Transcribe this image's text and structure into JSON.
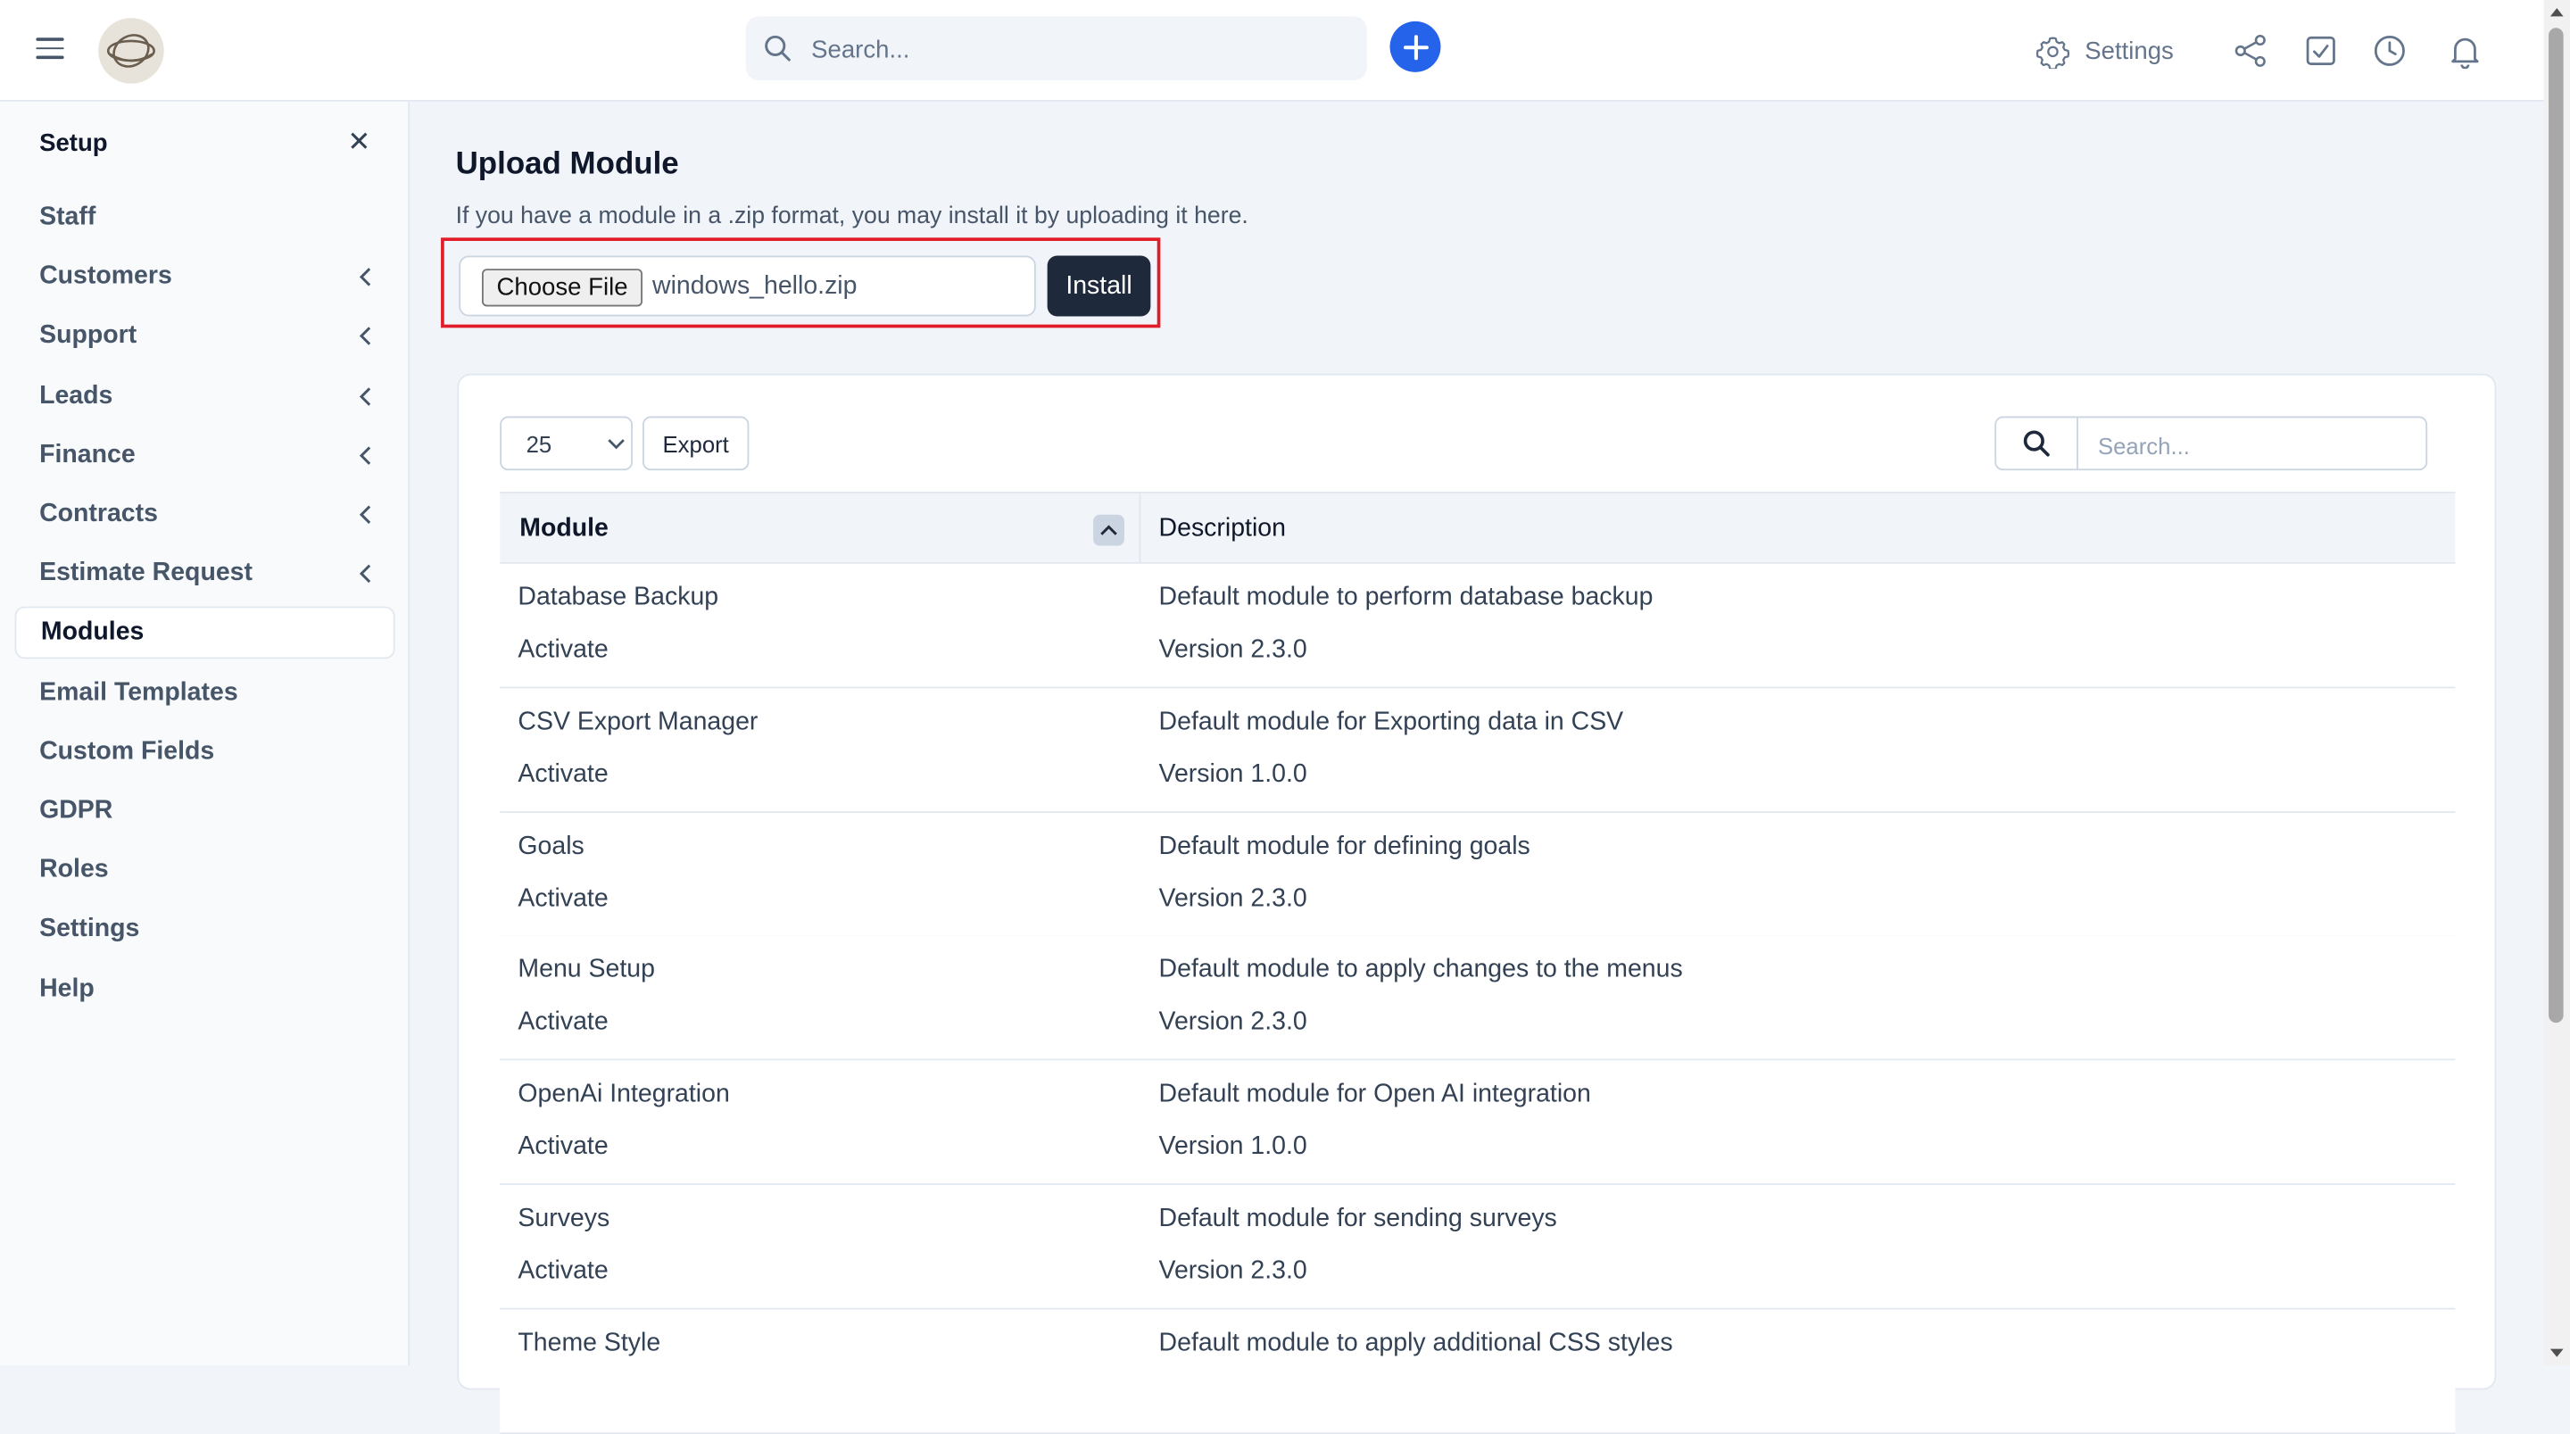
{
  "header": {
    "search_placeholder": "Search...",
    "settings_label": "Settings",
    "icons": [
      "menu-icon",
      "search-icon",
      "plus-icon",
      "gear-icon",
      "share-icon",
      "checkbox-icon",
      "clock-icon",
      "bell-icon"
    ],
    "accent_color": "#2563eb"
  },
  "sidebar": {
    "title": "Setup",
    "close_symbol": "✕",
    "items": [
      {
        "label": "Staff",
        "has_submenu": false
      },
      {
        "label": "Customers",
        "has_submenu": true
      },
      {
        "label": "Support",
        "has_submenu": true
      },
      {
        "label": "Leads",
        "has_submenu": true
      },
      {
        "label": "Finance",
        "has_submenu": true
      },
      {
        "label": "Contracts",
        "has_submenu": true
      },
      {
        "label": "Estimate Request",
        "has_submenu": true
      },
      {
        "label": "Modules",
        "has_submenu": false,
        "active": true
      },
      {
        "label": "Email Templates",
        "has_submenu": false
      },
      {
        "label": "Custom Fields",
        "has_submenu": false
      },
      {
        "label": "GDPR",
        "has_submenu": false
      },
      {
        "label": "Roles",
        "has_submenu": false
      },
      {
        "label": "Settings",
        "has_submenu": false
      },
      {
        "label": "Help",
        "has_submenu": false
      }
    ]
  },
  "upload": {
    "title": "Upload Module",
    "description": "If you have a module in a .zip format, you may install it by uploading it here.",
    "choose_file_label": "Choose File",
    "file_name": "windows_hello.zip",
    "install_label": "Install",
    "highlight_color": "#e11d2a"
  },
  "table": {
    "page_length": "25",
    "export_label": "Export",
    "search_placeholder": "Search...",
    "columns": [
      "Module",
      "Description"
    ],
    "rows": [
      {
        "module": "Database Backup",
        "action": "Activate",
        "description": "Default module to perform database backup",
        "version": "Version 2.3.0"
      },
      {
        "module": "CSV Export Manager",
        "action": "Activate",
        "description": "Default module for Exporting data in CSV",
        "version": "Version 1.0.0"
      },
      {
        "module": "Goals",
        "action": "Activate",
        "description": "Default module for defining goals",
        "version": "Version 2.3.0"
      },
      {
        "module": "Menu Setup",
        "action": "Activate",
        "description": "Default module to apply changes to the menus",
        "version": "Version 2.3.0"
      },
      {
        "module": "OpenAi Integration",
        "action": "Activate",
        "description": "Default module for Open AI integration",
        "version": "Version 1.0.0"
      },
      {
        "module": "Surveys",
        "action": "Activate",
        "description": "Default module for sending surveys",
        "version": "Version 2.3.0"
      },
      {
        "module": "Theme Style",
        "action": "",
        "description": "Default module to apply additional CSS styles",
        "version": ""
      }
    ]
  }
}
